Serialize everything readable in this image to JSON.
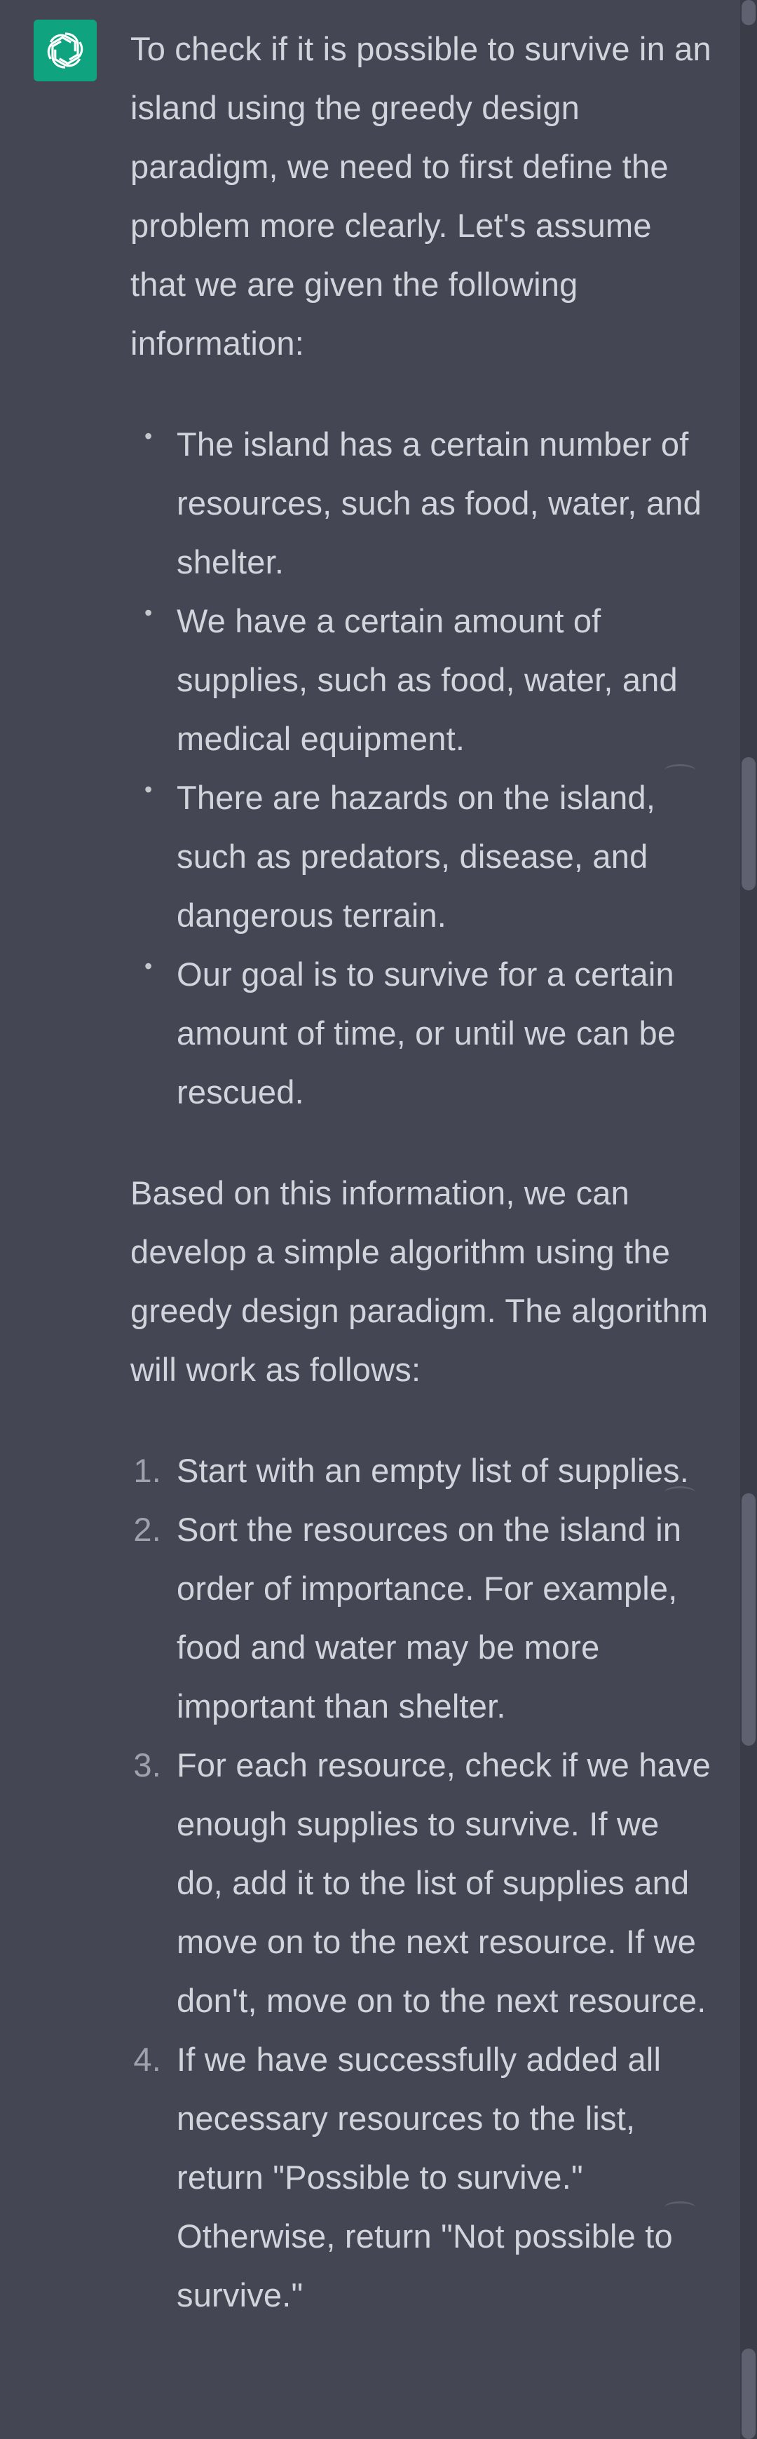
{
  "assistant": {
    "avatar_icon": "openai-logo-icon",
    "accent_color": "#10a37f"
  },
  "message": {
    "intro": "To check if it is possible to survive in an island using the greedy design paradigm, we need to first define the problem more clearly. Let's assume that we are given the following information:",
    "bullets": [
      "The island has a certain number of resources, such as food, water, and shelter.",
      "We have a certain amount of supplies, such as food, water, and medical equipment.",
      "There are hazards on the island, such as predators, disease, and dangerous terrain.",
      "Our goal is to survive for a certain amount of time, or until we can be rescued."
    ],
    "middle": "Based on this information, we can develop a simple algorithm using the greedy design paradigm. The algorithm will work as follows:",
    "steps": [
      {
        "num": "1.",
        "text": "Start with an empty list of supplies."
      },
      {
        "num": "2.",
        "text": "Sort the resources on the island in order of importance. For example, food and water may be more important than shelter."
      },
      {
        "num": "3.",
        "text": "For each resource, check if we have enough supplies to survive. If we do, add it to the list of supplies and move on to the next resource. If we don't, move on to the next resource."
      },
      {
        "num": "4.",
        "text": "If we have successfully added all necessary resources to the list, return \"Possible to survive.\" Otherwise, return \"Not possible to survive.\""
      }
    ]
  }
}
